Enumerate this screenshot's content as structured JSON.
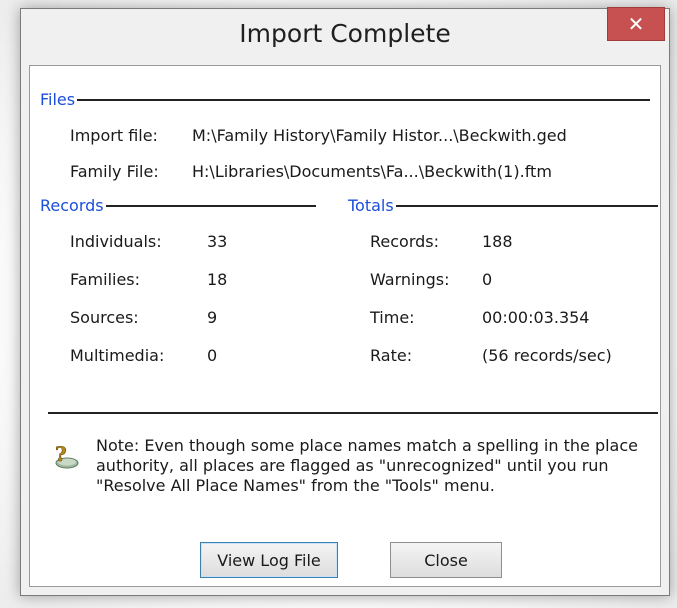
{
  "window": {
    "title": "Import Complete",
    "close_glyph": "✕"
  },
  "files": {
    "header": "Files",
    "import_label": "Import file:",
    "import_value": "M:\\Family History\\Family Histor...\\Beckwith.ged",
    "family_label": "Family File:",
    "family_value": "H:\\Libraries\\Documents\\Fa...\\Beckwith(1).ftm"
  },
  "records": {
    "header": "Records",
    "rows": [
      {
        "label": "Individuals:",
        "value": "33"
      },
      {
        "label": "Families:",
        "value": "18"
      },
      {
        "label": "Sources:",
        "value": "9"
      },
      {
        "label": "Multimedia:",
        "value": "0"
      }
    ]
  },
  "totals": {
    "header": "Totals",
    "rows": [
      {
        "label": "Records:",
        "value": "188"
      },
      {
        "label": "Warnings:",
        "value": "0"
      },
      {
        "label": "Time:",
        "value": "00:00:03.354"
      },
      {
        "label": "Rate:",
        "value": "(56 records/sec)"
      }
    ]
  },
  "note": {
    "icon": "help-note-icon",
    "text": "Note:  Even though some place names match a spelling in the place authority, all places are flagged as \"unrecognized\" until you run \"Resolve All Place Names\" from the \"Tools\" menu."
  },
  "buttons": {
    "view_log": "View Log File",
    "close": "Close"
  },
  "colors": {
    "section_header": "#1a4fdb",
    "close_button": "#c75050"
  }
}
